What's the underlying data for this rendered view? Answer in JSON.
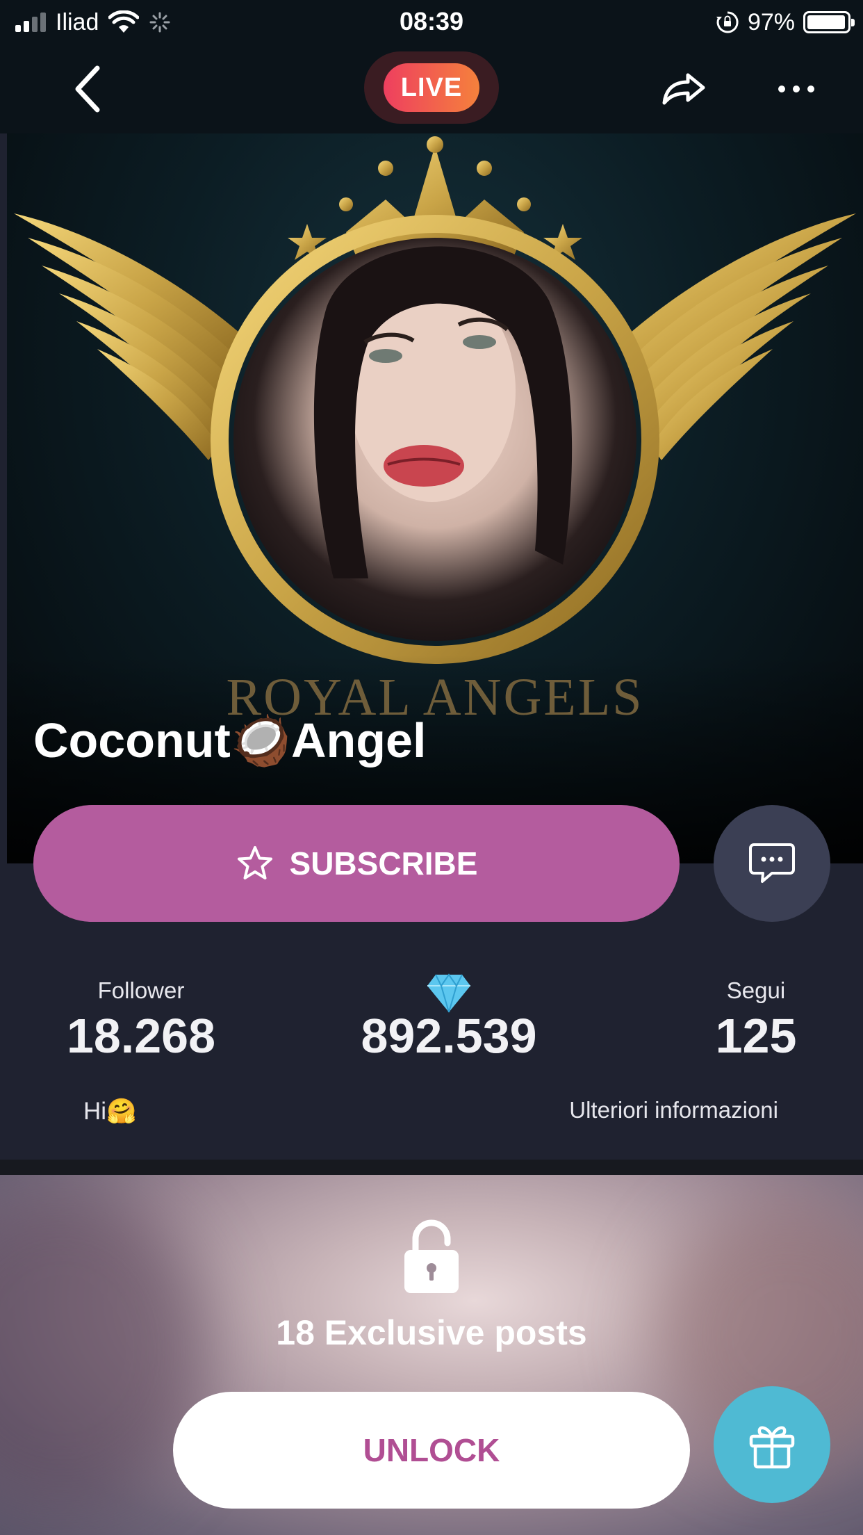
{
  "status_bar": {
    "carrier": "Iliad",
    "time": "08:39",
    "battery_percent": "97%",
    "battery_level": 0.97
  },
  "nav": {
    "live_label": "LIVE"
  },
  "hero": {
    "brand_text": "ROYAL ANGELS",
    "profile_name": "Coconut🥥Angel"
  },
  "actions": {
    "subscribe_label": "SUBSCRIBE"
  },
  "stats": {
    "followers": {
      "label": "Follower",
      "value": "18.268"
    },
    "diamonds": {
      "icon": "diamond-icon",
      "value": "892.539"
    },
    "following": {
      "label": "Segui",
      "value": "125"
    }
  },
  "bio": {
    "text": "Hi🤗",
    "more_info_label": "Ulteriori informazioni"
  },
  "locked": {
    "posts_text": "18 Exclusive posts",
    "unlock_label": "UNLOCK"
  },
  "colors": {
    "subscribe": "#b45c9e",
    "live_gradient_start": "#ee3f5f",
    "live_gradient_end": "#f5813c",
    "gift_button": "#4fbad3",
    "unlock_text": "#b04e93",
    "gold": "#c9a447"
  }
}
